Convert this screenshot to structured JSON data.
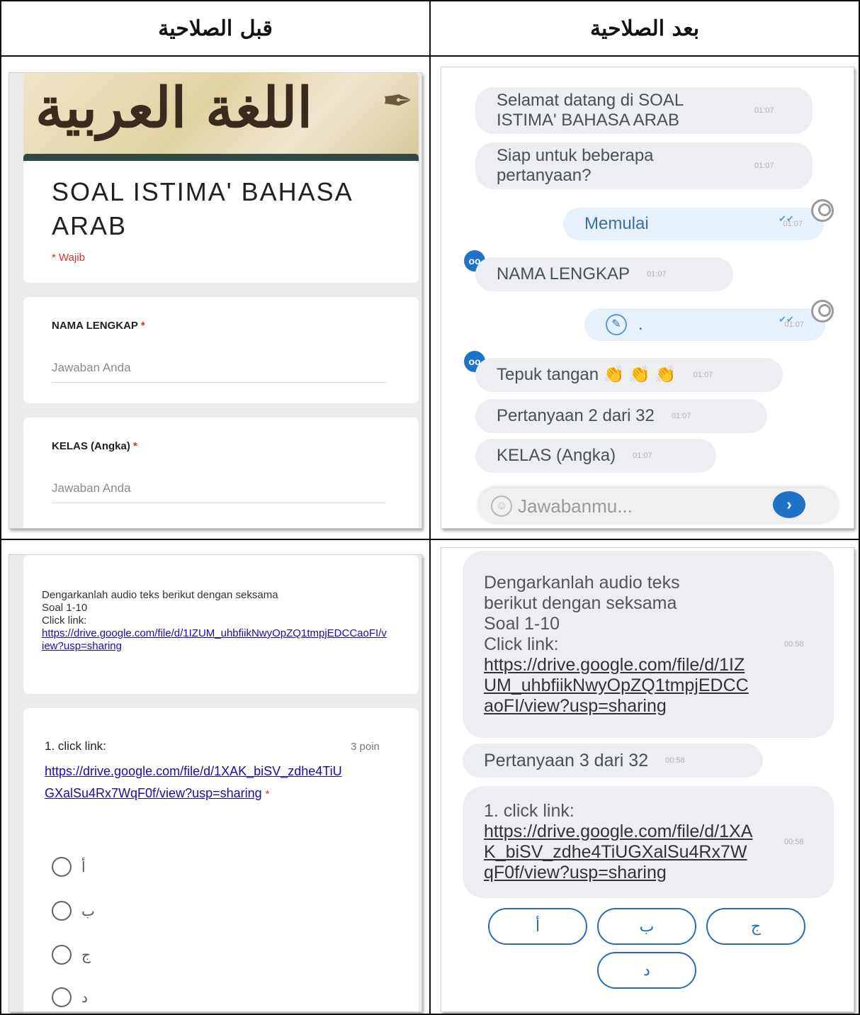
{
  "headers": {
    "left": "قبل الصلاحية",
    "right": "بعد الصلاحية"
  },
  "form_top": {
    "banner_text": "اللغة العربية",
    "title_line1": "SOAL ISTIMA' BAHASA",
    "title_line2": "ARAB",
    "required_note": "* Wajib",
    "q1_label": "NAMA LENGKAP",
    "q2_label": "KELAS (Angka)",
    "required_star": "*",
    "answer_placeholder": "Jawaban Anda"
  },
  "chat_top": {
    "messages": [
      {
        "text": "Selamat datang di SOAL ISTIMA' BAHASA ARAB",
        "time": "01:07"
      },
      {
        "text": "Siap untuk beberapa pertanyaan?",
        "time": "01:07"
      },
      {
        "text": "Memulai",
        "time": "01:07"
      },
      {
        "text": "NAMA LENGKAP",
        "time": "01:07"
      },
      {
        "text": ".",
        "time": "01:07"
      },
      {
        "text": "Tepuk tangan 👏 👏 👏",
        "time": "01:07"
      },
      {
        "text": "Pertanyaan 2 dari 32",
        "time": "01:07"
      },
      {
        "text": "KELAS (Angka)",
        "time": "01:07"
      }
    ],
    "input_placeholder": "Jawabanmu...",
    "send_glyph": "›"
  },
  "form_bottom": {
    "intro_line1": "Dengarkanlah audio teks berikut dengan seksama",
    "intro_line2": "Soal 1-10",
    "intro_line3": "Click link:",
    "intro_link": "https://drive.google.com/file/d/1IZUM_uhbfiikNwyOpZQ1tmpjEDCCaoFI/view?usp=sharing",
    "q_title": "1. click link:",
    "q_points": "3 poin",
    "q_link": "https://drive.google.com/file/d/1XAK_biSV_zdhe4TiUGXalSu4Rx7WqF0f/view?usp=sharing",
    "required_star": "*",
    "options": [
      "أ",
      "ب",
      "ج",
      "د"
    ]
  },
  "chat_bottom": {
    "msg1_lines": [
      "Dengarkanlah audio teks",
      "berikut dengan seksama",
      "Soal 1-10",
      "Click link:"
    ],
    "msg1_link": "https://drive.google.com/file/d/1IZUM_uhbfiikNwyOpZQ1tmpjEDCCaoFI/view?usp=sharing",
    "msg1_time": "00:58",
    "msg2": "Pertanyaan 3 dari 32",
    "msg2_time": "00:58",
    "msg3_title": "1. click link:",
    "msg3_link": "https://drive.google.com/file/d/1XAK_biSV_zdhe4TiUGXalSu4Rx7WqF0f/view?usp=sharing",
    "msg3_time": "00:58",
    "choices": [
      "أ",
      "ب",
      "ج",
      "د"
    ]
  }
}
